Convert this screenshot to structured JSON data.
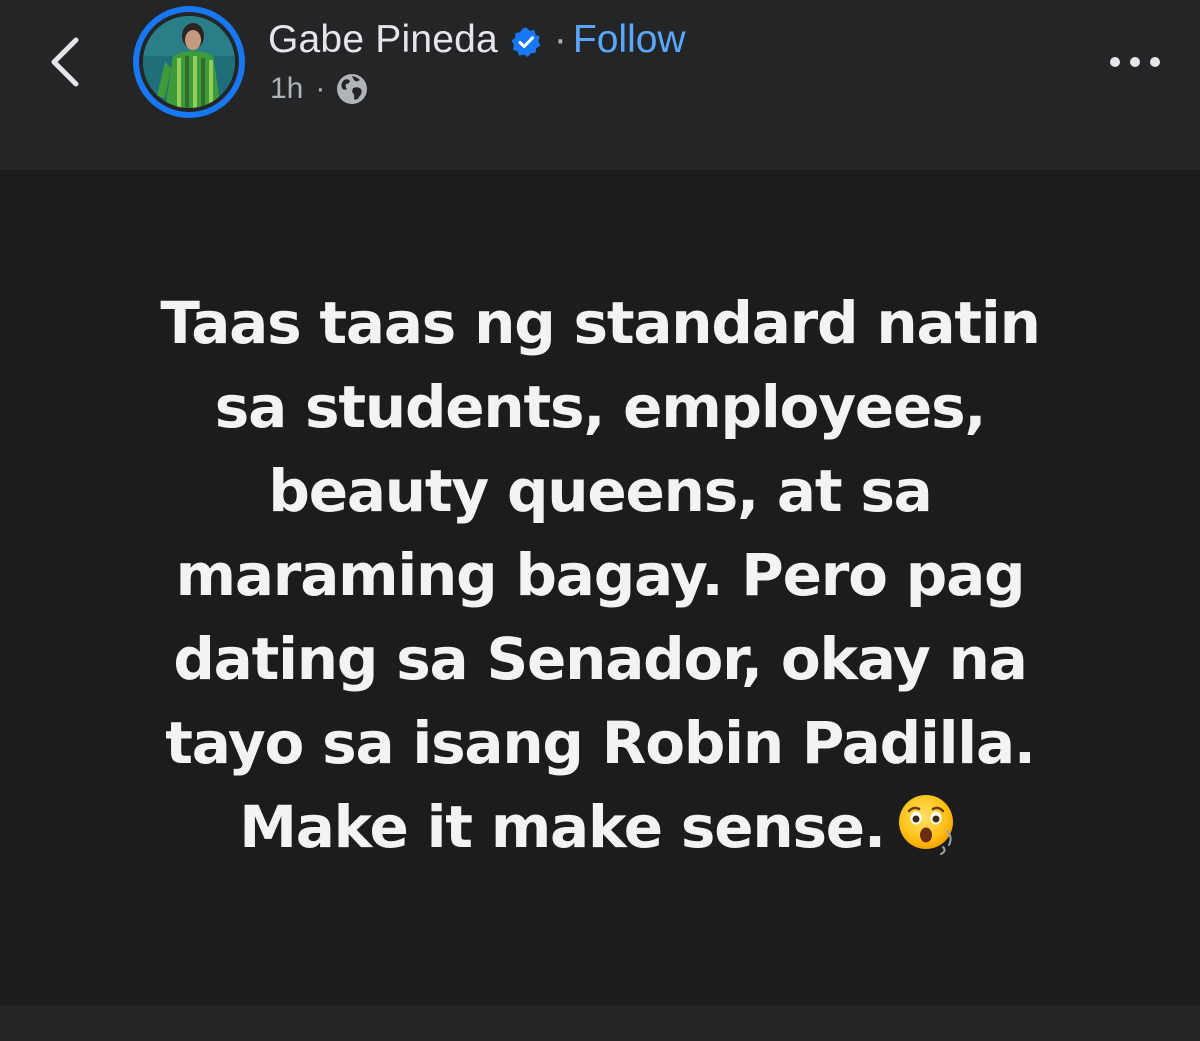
{
  "header": {
    "author_name": "Gabe Pineda",
    "separator": "·",
    "follow_label": "Follow",
    "timestamp": "1h",
    "meta_separator": "·",
    "audience_icon": "globe-icon",
    "verified_icon": "verified-badge-icon",
    "back_icon": "chevron-left-icon",
    "more_icon": "more-options-icon"
  },
  "post": {
    "lines": [
      "Taas taas ng standard natin",
      "sa students, employees,",
      "beauty queens, at sa",
      "maraming bagay. Pero pag",
      "dating sa Senador, okay na",
      "tayo sa isang Robin Padilla.",
      "Make it make sense."
    ],
    "emoji": "astonished-face-emoji"
  },
  "colors": {
    "app_background": "#242526",
    "post_background": "#1c1c1d",
    "accent_blue": "#1877f2",
    "follow_blue": "#5aa7ff",
    "primary_text": "#e4e6eb",
    "secondary_text": "#b0b3b8"
  }
}
